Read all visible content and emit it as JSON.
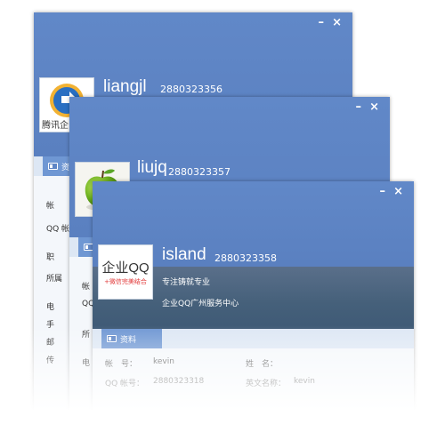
{
  "windows": [
    {
      "name": "liangjl",
      "id": "2880323356",
      "avatar_caption": "腾讯企",
      "tab_label": "资",
      "rows": [
        "帐",
        "QQ 帐",
        "职",
        "所属",
        "电",
        "手",
        "邮",
        "传"
      ],
      "controls": {
        "minimize": "–",
        "close": "×"
      }
    },
    {
      "name": "liujq",
      "id": "2880323357",
      "tab_label": "资",
      "rows": [
        "帐",
        "QQ",
        "所",
        "电"
      ],
      "controls": {
        "minimize": "–",
        "close": "×"
      }
    },
    {
      "name": "island",
      "id": "2880323358",
      "avatar_main": "企业QQ",
      "avatar_sub": "+微信完美结合",
      "signature": "专注铸就专业",
      "department": "企业QQ广州服务中心",
      "tab_label": "资料",
      "fields": [
        {
          "label": "帐　号：",
          "value": "kevin",
          "label2": "姓　名："
        },
        {
          "label": "QQ 帐号：",
          "value": "2880323318",
          "label2": "英文名称：",
          "value2": "kevin"
        }
      ],
      "controls": {
        "minimize": "–",
        "close": "×"
      }
    }
  ]
}
